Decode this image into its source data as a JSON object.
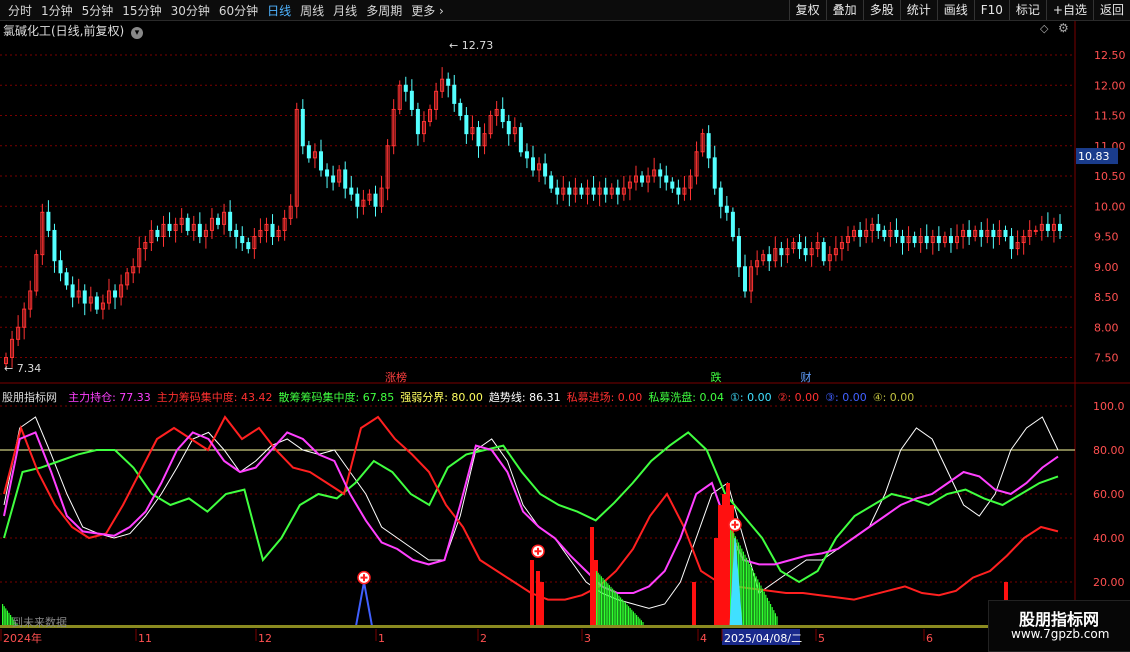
{
  "toolbar": {
    "periods": [
      "分时",
      "1分钟",
      "5分钟",
      "15分钟",
      "30分钟",
      "60分钟",
      "日线",
      "周线",
      "月线",
      "多周期",
      "更多"
    ],
    "active_period": "日线",
    "right_buttons": [
      "复权",
      "叠加",
      "多股",
      "统计",
      "画线",
      "F10",
      "标记",
      "+自选",
      "返回"
    ]
  },
  "stock": {
    "title": "氯碱化工(日线,前复权)"
  },
  "price_panel": {
    "high_label": "12.73",
    "low_label": "7.34",
    "current_price": "10.83",
    "yticks": [
      "12.50",
      "12.00",
      "11.50",
      "11.00",
      "10.50",
      "10.00",
      "9.50",
      "9.00",
      "8.50",
      "8.00",
      "7.50"
    ],
    "yvalues": [
      12.5,
      12.0,
      11.5,
      11.0,
      10.5,
      10.0,
      9.5,
      9.0,
      8.5,
      8.0,
      7.5
    ],
    "markers": [
      {
        "text": "涨榜",
        "color": "#ff4040"
      },
      {
        "text": "跌",
        "color": "#40ff40"
      },
      {
        "text": "财",
        "color": "#60a0ff"
      }
    ]
  },
  "indicator": {
    "name": "股朋指标网",
    "legend": [
      {
        "label": "主力持仓:",
        "value": "77.33",
        "color": "#ff40ff"
      },
      {
        "label": "主力筹码集中度:",
        "value": "43.42",
        "color": "#ff3030"
      },
      {
        "label": "散筹筹码集中度:",
        "value": "67.85",
        "color": "#40ff40"
      },
      {
        "label": "强弱分界:",
        "value": "80.00",
        "color": "#ffff60"
      },
      {
        "label": "趋势线:",
        "value": "86.31",
        "color": "#ffffff"
      },
      {
        "label": "私募进场:",
        "value": "0.00",
        "color": "#ff3030"
      },
      {
        "label": "私募洗盘:",
        "value": "0.04",
        "color": "#40ff40"
      },
      {
        "label": "①:",
        "value": "0.00",
        "color": "#40e0ff"
      },
      {
        "label": "②:",
        "value": "0.00",
        "color": "#ff3030"
      },
      {
        "label": "③:",
        "value": "0.00",
        "color": "#4060ff"
      },
      {
        "label": "④:",
        "value": "0.00",
        "color": "#c0c040"
      }
    ],
    "yticks": [
      "100.0",
      "80.00",
      "60.00",
      "40.00",
      "20.00"
    ],
    "yvalues": [
      100,
      80,
      60,
      40,
      20
    ],
    "overlay_text": "到未来数据"
  },
  "date_axis": {
    "labels": [
      "2024年",
      "11",
      "12",
      "1",
      "2",
      "3",
      "4",
      "2025/04/08/二",
      "5",
      "6"
    ],
    "highlighted": "2025/04/08/二"
  },
  "watermark": {
    "line1": "股朋指标网",
    "line2": "www.7gpzb.com"
  },
  "colors": {
    "up": "#ff3232",
    "down": "#54ffff",
    "bg": "#000000",
    "grid": "#7a0000"
  }
}
